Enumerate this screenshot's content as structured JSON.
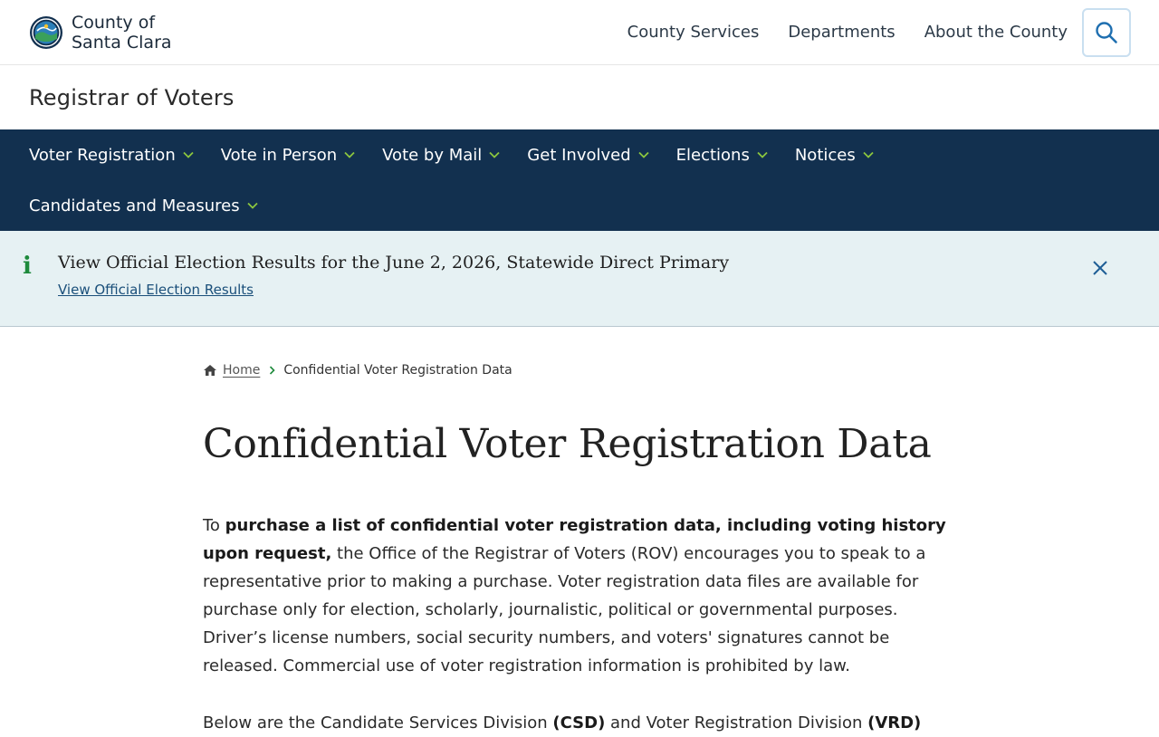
{
  "header": {
    "brand_line1": "County of",
    "brand_line2": "Santa Clara",
    "nav": [
      "County Services",
      "Departments",
      "About the County"
    ],
    "search_icon": "search-icon"
  },
  "department": {
    "title": "Registrar of Voters"
  },
  "main_nav": {
    "row1": [
      "Voter Registration",
      "Vote in Person",
      "Vote by Mail",
      "Get Involved",
      "Elections",
      "Notices"
    ],
    "row2": [
      "Candidates and Measures"
    ]
  },
  "alert": {
    "icon": "i",
    "title": "View Official Election Results for the June 2, 2026, Statewide Direct Primary",
    "link_label": "View Official Election Results"
  },
  "breadcrumb": {
    "home": "Home",
    "current": "Confidential Voter Registration Data"
  },
  "page": {
    "title": "Confidential Voter Registration Data",
    "para1_prefix": "To ",
    "para1_bold": "purchase a list of confidential voter registration data, including voting history upon request,",
    "para1_rest": " the Office of the Registrar of Voters (ROV) encourages you to speak to a representative prior to making a purchase. Voter registration data files are available for purchase only for election, scholarly, journalistic, political or governmental purposes. Driver’s license numbers, social security numbers, and voters' signatures cannot be released. Commercial use of voter registration information is prohibited by law.",
    "para2_a": "Below are the Candidate Services Division ",
    "para2_b": "(CSD)",
    "para2_c": " and Voter Registration Division ",
    "para2_d": "(VRD)"
  },
  "colors": {
    "nav_bg": "#12304f",
    "alert_bg": "#e6f1f3",
    "chevron": "#8cc63f",
    "info_icon": "#1e8a3c"
  }
}
